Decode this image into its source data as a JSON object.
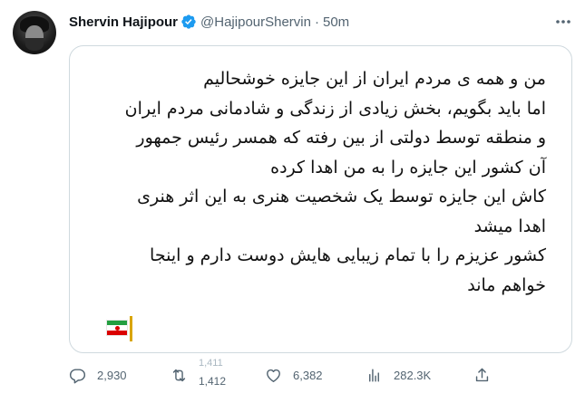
{
  "tweet": {
    "author_name": "Shervin Hajipour",
    "handle": "@HajipourShervin",
    "separator": "·",
    "time": "50m",
    "lines": [
      "من و همه ی مردم ایران از این جایزه خوشحالیم",
      "اما باید بگویم، بخش زیادی از زندگی و شادمانی مردم ایران",
      "و منطقه توسط دولتی از بین رفته که همسر رئیس جمهور",
      "آن کشور این جایزه را به من اهدا کرده",
      "کاش این جایزه توسط یک شخصیت هنری به این اثر هنری",
      "اهدا میشد",
      "کشور عزیزم را با تمام زیبایی هایش دوست دارم و اینجا",
      "خواهم ماند"
    ]
  },
  "actions": {
    "replies": "2,930",
    "retweets_previous": "1,411",
    "retweets": "1,412",
    "likes": "6,382",
    "views": "282.3K"
  },
  "colors": {
    "verified": "#1d9bf0",
    "secondary_text": "#536471",
    "border": "#cfd9de"
  }
}
